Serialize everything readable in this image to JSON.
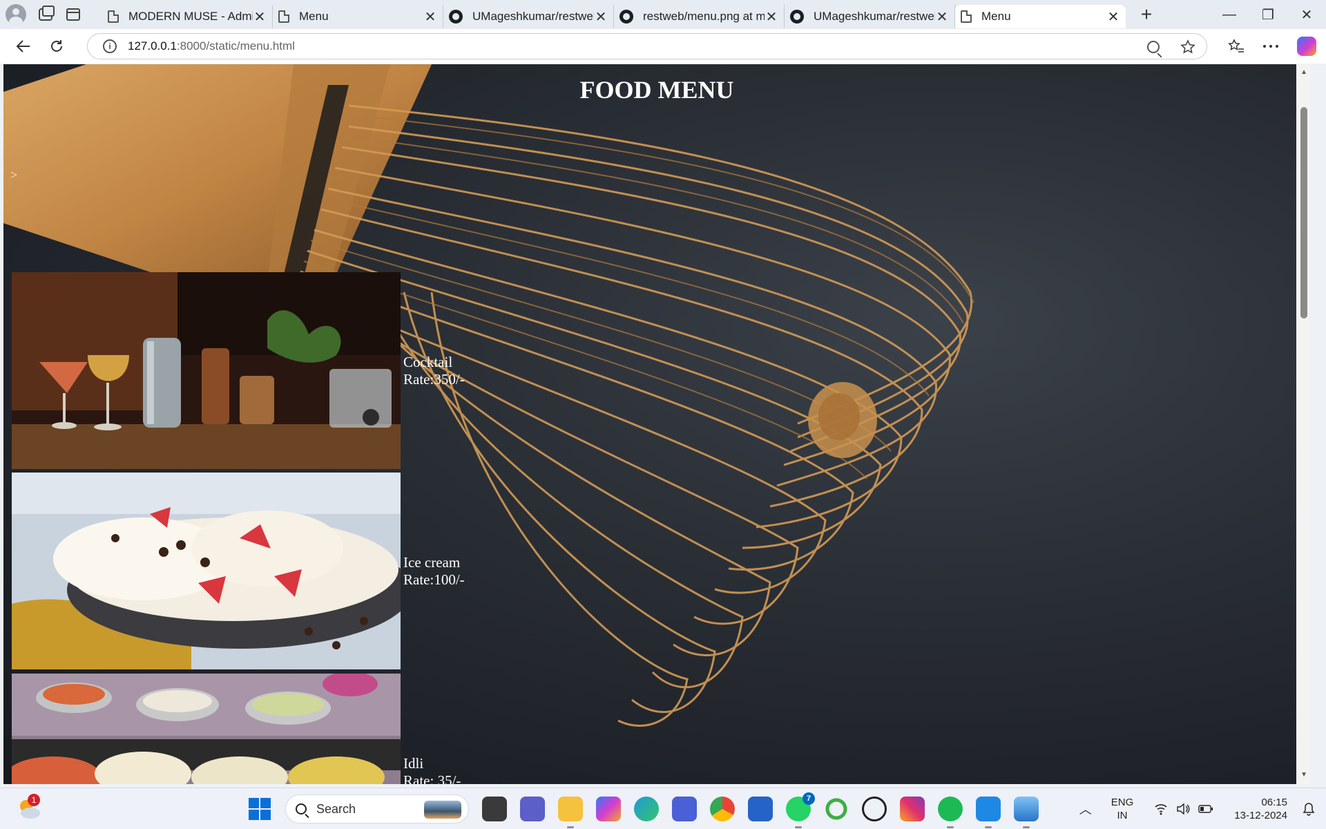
{
  "browser": {
    "tabs": [
      {
        "title": "MODERN MUSE - Admini",
        "icon": "doc",
        "active": false
      },
      {
        "title": "Menu",
        "icon": "doc",
        "active": false
      },
      {
        "title": "UMageshkumar/restweb",
        "icon": "github",
        "active": false
      },
      {
        "title": "restweb/menu.png at mai",
        "icon": "github",
        "active": false
      },
      {
        "title": "UMageshkumar/restweb",
        "icon": "github",
        "active": false
      },
      {
        "title": "Menu",
        "icon": "doc",
        "active": true
      }
    ],
    "new_tab": "+",
    "close_glyph": "✕",
    "window_controls": {
      "minimize": "—",
      "restore": "❐",
      "close": "✕"
    },
    "url_host": "127.0.0.1",
    "url_rest": ":8000/static/menu.html"
  },
  "page": {
    "title": "FOOD MENU",
    "stray_text": ">",
    "items": [
      {
        "name": "Cocktail",
        "rate": "Rate:350/-",
        "photo": "cocktail"
      },
      {
        "name": "Ice cream",
        "rate": "Rate:100/-",
        "photo": "ice-cream"
      },
      {
        "name": "Idli",
        "rate": "Rate: 35/-",
        "photo": "idli"
      }
    ],
    "scroll_fraction": 0.06
  },
  "taskbar": {
    "weather_badge": "1",
    "search_label": "Search",
    "whatsapp_badge": "7",
    "lang_top": "ENG",
    "lang_bottom": "IN",
    "time": "06:15",
    "date": "13-12-2024"
  }
}
